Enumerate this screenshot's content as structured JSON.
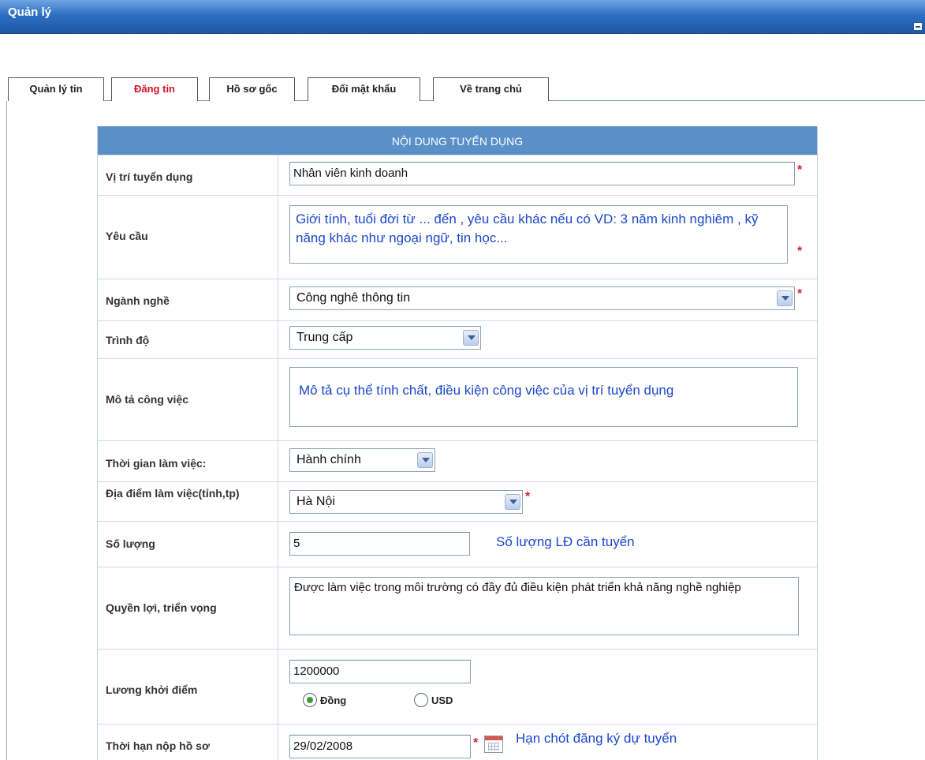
{
  "window": {
    "title": "Quản lý"
  },
  "tabs": [
    {
      "label": "Quản lý tin"
    },
    {
      "label": "Đăng tin",
      "active": true
    },
    {
      "label": "Hồ sơ gốc"
    },
    {
      "label": "Đổi mật khẩu"
    },
    {
      "label": "Về trang chủ"
    }
  ],
  "form": {
    "header": "NỘI DUNG TUYỂN DỤNG",
    "required_mark": "*",
    "fields": {
      "position": {
        "label": "Vị trí tuyển dụng",
        "value": "Nhân viên kinh doanh"
      },
      "requirements": {
        "label": "Yêu cầu",
        "hint": "Giới tính, tuổi đời từ ... đến , yêu cầu khác nếu có VD: 3 năm kinh nghiêm , kỹ năng khác như ngoại ngữ, tin học..."
      },
      "industry": {
        "label": "Ngành nghề",
        "value": "Công nghê thông tin"
      },
      "education": {
        "label": "Trình độ",
        "value": "Trung cấp"
      },
      "job_description": {
        "label": "Mô tả công việc",
        "hint": "Mô tả cụ thể tính chất, điều kiện công việc của vị trí tuyển dụng"
      },
      "working_time": {
        "label": "Thời gian làm việc:",
        "value": "Hành chính"
      },
      "location": {
        "label": "Địa điểm làm việc(tỉnh,tp)",
        "value": "Hà Nội"
      },
      "quantity": {
        "label": "Số lượng",
        "value": "5",
        "hint": "Số lượng LĐ cần tuyển"
      },
      "benefits": {
        "label": "Quyền lợi, triển vọng",
        "value": "Được làm việc trong môi trường có đầy đủ điều kiện phát triển khả năng nghề nghiệp"
      },
      "salary": {
        "label": "Lương khởi điểm",
        "value": "1200000",
        "currency_options": [
          "Đồng",
          "USD"
        ],
        "selected_currency": "Đồng"
      },
      "deadline": {
        "label": "Thời hạn nộp hồ sơ",
        "value": "29/02/2008",
        "hint": "Hạn chót đăng ký dự tuyển"
      }
    }
  }
}
